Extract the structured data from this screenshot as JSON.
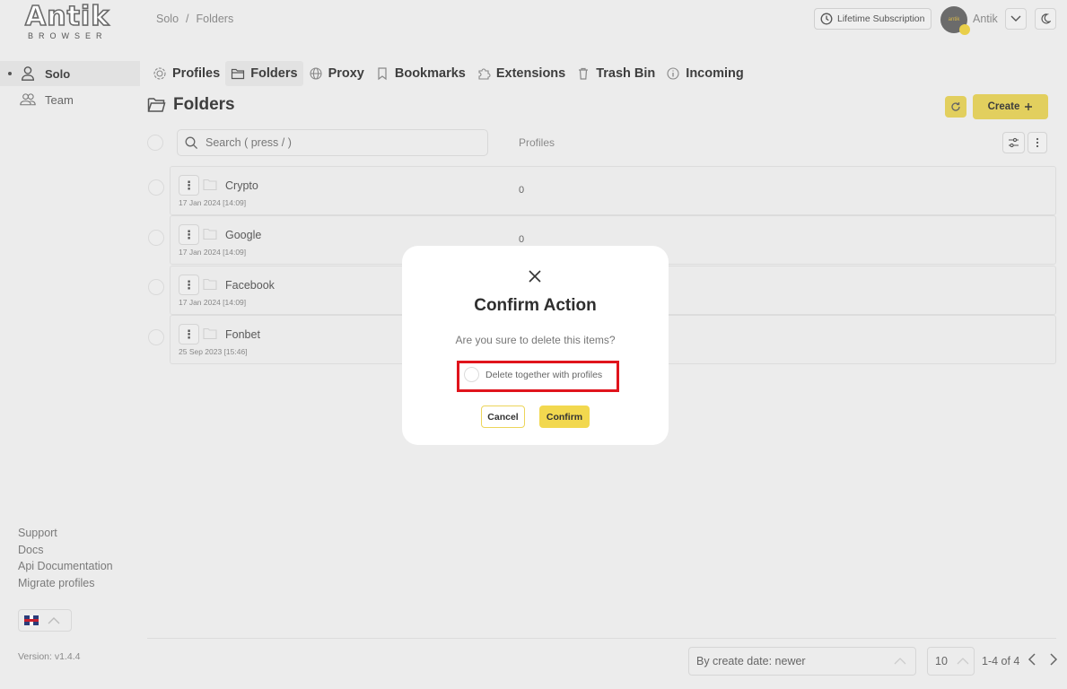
{
  "logo": {
    "word": "Antik",
    "sub": "BROWSER"
  },
  "sidebar": {
    "items": [
      {
        "label": "Solo",
        "icon": "user-icon",
        "active": true
      },
      {
        "label": "Team",
        "icon": "users-icon",
        "active": false
      }
    ],
    "links": [
      "Support",
      "Docs",
      "Api Documentation",
      "Migrate profiles"
    ],
    "language": "gb-flag",
    "version": "Version: v1.4.4"
  },
  "header": {
    "breadcrumb": [
      "Solo",
      "Folders"
    ],
    "subscription_label": "Lifetime Subscription",
    "username": "Antik",
    "avatar_text": "antik"
  },
  "tabs": [
    {
      "label": "Profiles",
      "icon": "fingerprint-icon"
    },
    {
      "label": "Folders",
      "icon": "folder-icon",
      "active": true
    },
    {
      "label": "Proxy",
      "icon": "globe-icon"
    },
    {
      "label": "Bookmarks",
      "icon": "bookmark-icon"
    },
    {
      "label": "Extensions",
      "icon": "puzzle-icon"
    },
    {
      "label": "Trash Bin",
      "icon": "trash-icon"
    },
    {
      "label": "Incoming",
      "icon": "info-icon"
    }
  ],
  "page": {
    "title": "Folders",
    "create_label": "Create",
    "search_placeholder": "Search ( press / )",
    "column_profiles": "Profiles"
  },
  "folders": [
    {
      "name": "Crypto",
      "date": "17 Jan 2024 [14:09]",
      "profiles": "0"
    },
    {
      "name": "Google",
      "date": "17 Jan 2024 [14:09]",
      "profiles": "0"
    },
    {
      "name": "Facebook",
      "date": "17 Jan 2024 [14:09]",
      "profiles": ""
    },
    {
      "name": "Fonbet",
      "date": "25 Sep 2023 [15:46]",
      "profiles": ""
    }
  ],
  "footer": {
    "sort_label": "By create date: newer",
    "per_page": "10",
    "range": "1-4 of 4"
  },
  "modal": {
    "title": "Confirm Action",
    "message": "Are you sure to delete this items?",
    "checkbox_label": "Delete together with profiles",
    "cancel_label": "Cancel",
    "confirm_label": "Confirm"
  },
  "colors": {
    "accent": "#e2cf5e",
    "accent_bright": "#f2d84f",
    "highlight": "#e0141c",
    "background": "#ececec"
  }
}
